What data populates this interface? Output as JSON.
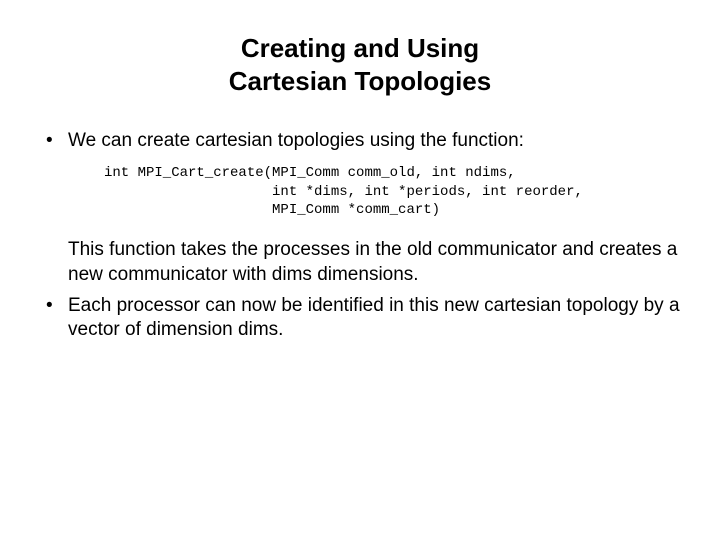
{
  "title_line1": "Creating and Using",
  "title_line2": "Cartesian Topologies",
  "bullet1": "We can create cartesian topologies using the function:",
  "code_line1": "int MPI_Cart_create(MPI_Comm comm_old, int ndims,",
  "code_line2": "                    int *dims, int *periods, int reorder,",
  "code_line3": "                    MPI_Comm *comm_cart)",
  "para1": "This function takes the processes in the old communicator and creates a new communicator with dims dimensions.",
  "bullet2": "Each processor can now be identified in this new cartesian topology by a vector of dimension dims."
}
